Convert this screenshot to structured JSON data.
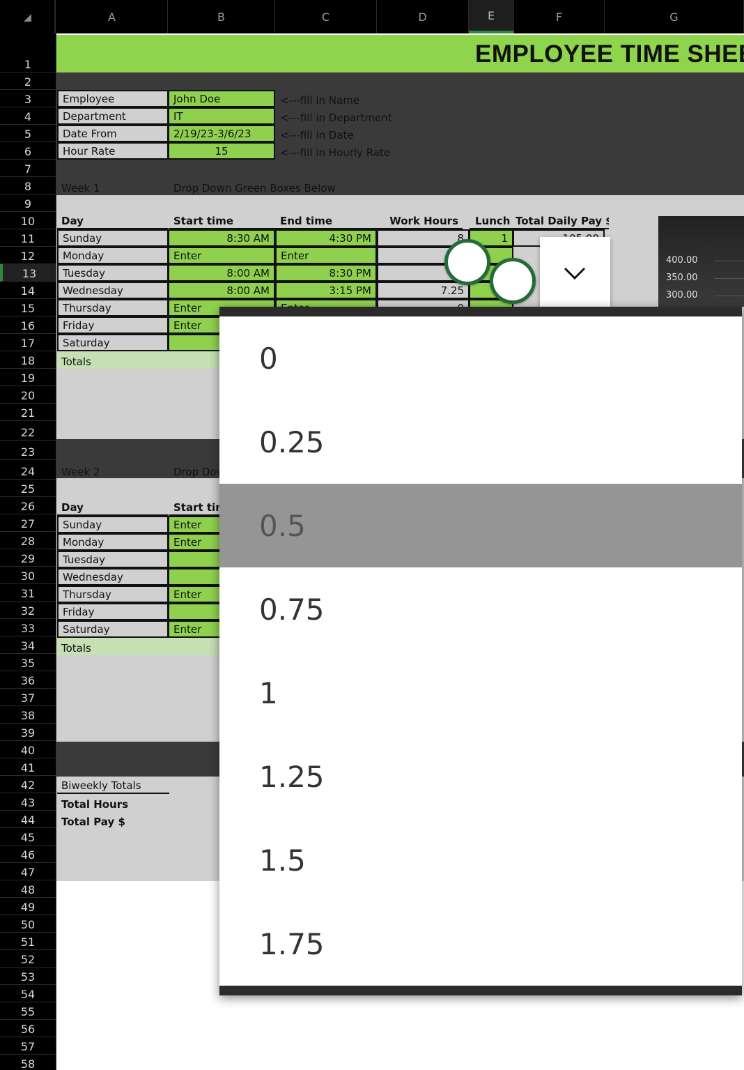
{
  "sheet": {
    "columns": [
      "A",
      "B",
      "C",
      "D",
      "E",
      "F",
      "G"
    ],
    "selected_column": "E",
    "selected_row": "13",
    "rows": [
      "1",
      "2",
      "3",
      "4",
      "5",
      "6",
      "7",
      "8",
      "9",
      "10",
      "11",
      "12",
      "13",
      "14",
      "15",
      "16",
      "17",
      "18",
      "19",
      "20",
      "21",
      "22",
      "23",
      "24",
      "25",
      "26",
      "27",
      "28",
      "29",
      "30",
      "31",
      "32",
      "33",
      "34",
      "35",
      "36",
      "37",
      "38",
      "39",
      "40",
      "41",
      "42",
      "43",
      "44",
      "45",
      "46",
      "47",
      "48",
      "49",
      "50",
      "51",
      "52",
      "53",
      "54",
      "55",
      "56",
      "57",
      "58"
    ],
    "title": "EMPLOYEE TIME SHEE",
    "info": [
      {
        "label": "Employee",
        "value": "John Doe",
        "hint": "<---fill in Name"
      },
      {
        "label": "Department",
        "value": "IT",
        "hint": "<---fill in Department"
      },
      {
        "label": "Date From",
        "value": "2/19/23-3/6/23",
        "hint": "<---fill in Date"
      },
      {
        "label": "Hour Rate",
        "value": "15",
        "hint": "<---fill in Hourly Rate"
      }
    ],
    "week1": {
      "label": "Week 1",
      "instruction": "Drop Down Green Boxes Below",
      "headers": {
        "day": "Day",
        "start": "Start time",
        "end": "End time",
        "work": "Work Hours",
        "lunch": "Lunch",
        "pay": "Total Daily Pay $"
      },
      "rows": [
        {
          "day": "Sunday",
          "start": "8:30 AM",
          "end": "4:30 PM",
          "work": "8",
          "lunch": "1",
          "pay": "105.00"
        },
        {
          "day": "Monday",
          "start": "Enter",
          "end": "Enter",
          "work": "",
          "lunch": "",
          "pay": ""
        },
        {
          "day": "Tuesday",
          "start": "8:00 AM",
          "end": "8:30 PM",
          "work": "1",
          "lunch": "",
          "pay": ""
        },
        {
          "day": "Wednesday",
          "start": "8:00 AM",
          "end": "3:15 PM",
          "work": "7.25",
          "lunch": "",
          "pay": ""
        },
        {
          "day": "Thursday",
          "start": "Enter",
          "end": "Enter",
          "work": "0",
          "lunch": "",
          "pay": ""
        },
        {
          "day": "Friday",
          "start": "Enter",
          "end": "",
          "work": "",
          "lunch": "",
          "pay": ""
        },
        {
          "day": "Saturday",
          "start": "",
          "end": "",
          "work": "",
          "lunch": "",
          "pay": ""
        }
      ],
      "totals": "Totals"
    },
    "week2": {
      "label": "Week 2",
      "instruction": "Drop Dov",
      "headers": {
        "day": "Day",
        "start": "Start tim"
      },
      "rows": [
        {
          "day": "Sunday",
          "start": "Enter"
        },
        {
          "day": "Monday",
          "start": "Enter"
        },
        {
          "day": "Tuesday",
          "start": ""
        },
        {
          "day": "Wednesday",
          "start": ""
        },
        {
          "day": "Thursday",
          "start": "Enter"
        },
        {
          "day": "Friday",
          "start": ""
        },
        {
          "day": "Saturday",
          "start": "Enter"
        }
      ],
      "totals": "Totals"
    },
    "biweekly": {
      "label": "Biweekly Totals",
      "hours": "Total Hours",
      "pay": "Total Pay $"
    },
    "chart_ticks": [
      "400.00",
      "350.00",
      "300.00"
    ]
  },
  "dropdown": {
    "icon": "chevron-down-icon",
    "selected": "0.5",
    "options": [
      "0",
      "0.25",
      "0.5",
      "0.75",
      "1",
      "1.25",
      "1.5",
      "1.75"
    ]
  },
  "colors": {
    "accent_green": "#8fd14f",
    "handle_green": "#246b3a",
    "dark_bg": "#3a3a3a"
  }
}
